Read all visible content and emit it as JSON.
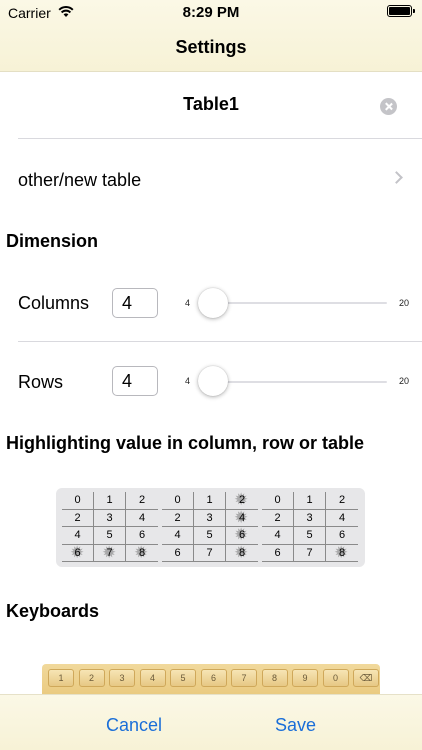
{
  "status": {
    "carrier": "Carrier",
    "time": "8:29 PM"
  },
  "nav": {
    "title": "Settings"
  },
  "table": {
    "name": "Table1",
    "other_label": "other/new table"
  },
  "dimension": {
    "title": "Dimension",
    "columns": {
      "label": "Columns",
      "value": "4",
      "min": "4",
      "max": "20"
    },
    "rows": {
      "label": "Rows",
      "value": "4",
      "min": "4",
      "max": "20"
    }
  },
  "highlighting": {
    "title": "Highlighting value in column, row or table",
    "grids": [
      [
        "0",
        "1",
        "2",
        "2",
        "3",
        "4",
        "4",
        "5",
        "6",
        "6",
        "7",
        "8"
      ],
      [
        "0",
        "1",
        "2",
        "2",
        "3",
        "4",
        "4",
        "5",
        "6",
        "6",
        "7",
        "8"
      ],
      [
        "0",
        "1",
        "2",
        "2",
        "3",
        "4",
        "4",
        "5",
        "6",
        "6",
        "7",
        "8"
      ]
    ]
  },
  "keyboards": {
    "title": "Keyboards",
    "keys": [
      "1",
      "2",
      "3",
      "4",
      "5",
      "6",
      "7",
      "8",
      "9",
      "0",
      "⌫"
    ]
  },
  "toolbar": {
    "cancel": "Cancel",
    "save": "Save"
  }
}
